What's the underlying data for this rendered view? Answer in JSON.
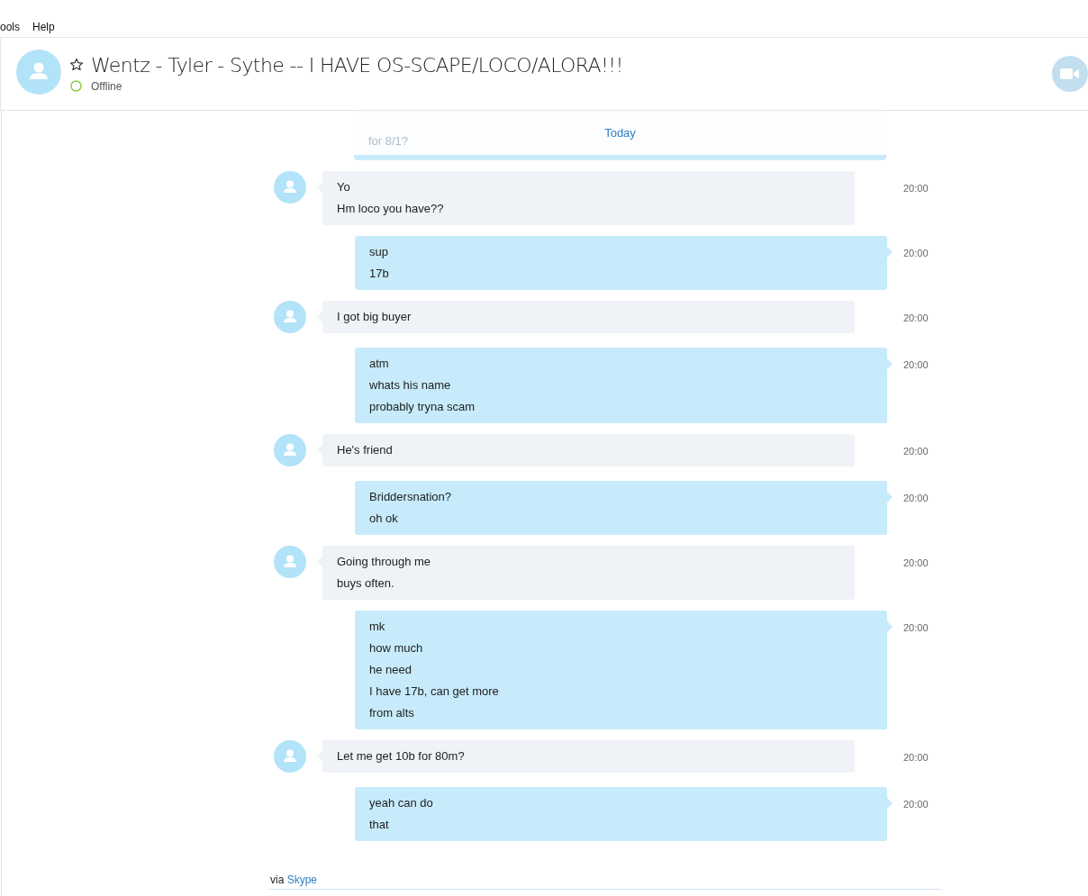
{
  "menu": [
    "ools",
    "Help"
  ],
  "header": {
    "title": "Wentz - Tyler - Sythe -- I HAVE OS-SCAPE/LOCO/ALORA!!!",
    "status": "Offline"
  },
  "chat": {
    "faded_message": "for 8/1?",
    "date_divider": "Today",
    "messages": [
      {
        "kind": "incoming",
        "lines": [
          "Yo",
          "Hm loco you have??"
        ],
        "time": "20:00"
      },
      {
        "kind": "outgoing",
        "lines": [
          "sup",
          "17b"
        ],
        "time": "20:00"
      },
      {
        "kind": "incoming",
        "lines": [
          "I got big buyer"
        ],
        "time": "20:00"
      },
      {
        "kind": "outgoing",
        "lines": [
          "atm",
          "whats his name",
          "probably tryna scam"
        ],
        "time": "20:00"
      },
      {
        "kind": "incoming",
        "lines": [
          "He's friend"
        ],
        "time": "20:00"
      },
      {
        "kind": "outgoing",
        "lines": [
          "Briddersnation?",
          "oh ok"
        ],
        "time": "20:00"
      },
      {
        "kind": "incoming",
        "lines": [
          "Going through me",
          "buys often."
        ],
        "time": "20:00"
      },
      {
        "kind": "outgoing",
        "lines": [
          "mk",
          "how much",
          "he need",
          "I have 17b, can get more",
          "from alts"
        ],
        "time": "20:00"
      },
      {
        "kind": "incoming",
        "lines": [
          "Let me get 10b for 80m?"
        ],
        "time": "20:00"
      },
      {
        "kind": "outgoing",
        "lines": [
          "yeah can do",
          "that"
        ],
        "time": "20:00"
      }
    ]
  },
  "footer": {
    "via": "via",
    "link": "Skype"
  }
}
